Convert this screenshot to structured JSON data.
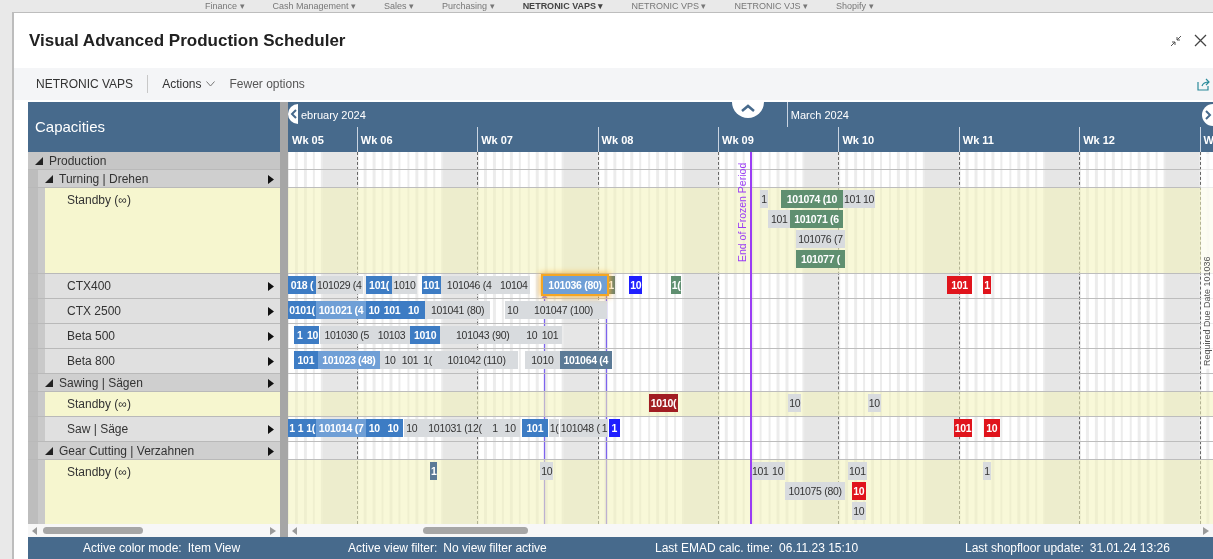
{
  "background_nav": [
    {
      "label": "Finance ▾",
      "selected": false
    },
    {
      "label": "Cash Management ▾",
      "selected": false
    },
    {
      "label": "Sales ▾",
      "selected": false
    },
    {
      "label": "Purchasing ▾",
      "selected": false
    },
    {
      "label": "NETRONIC VAPS ▾",
      "selected": true
    },
    {
      "label": "NETRONIC VPS ▾",
      "selected": false
    },
    {
      "label": "NETRONIC VJS ▾",
      "selected": false
    },
    {
      "label": "Shopify ▾",
      "selected": false
    }
  ],
  "window": {
    "title": "Visual Advanced Production Scheduler"
  },
  "action_bar": {
    "app": "NETRONIC VAPS",
    "actions": "Actions",
    "fewer_options": "Fewer options"
  },
  "timeline": {
    "months": [
      "ebruary 2024",
      "March 2024"
    ],
    "weeks": [
      "Wk 05",
      "Wk 06",
      "Wk 07",
      "Wk 08",
      "Wk 09",
      "Wk 10",
      "Wk 11",
      "Wk 12",
      "W"
    ],
    "frozen_period_label": "End of Frozen Period",
    "due_date_label": "Required Due Date 101036"
  },
  "capacities": {
    "title": "Capacities",
    "rows": [
      {
        "label": "Production",
        "kind": "group",
        "expanded": true,
        "menu": false,
        "children": [
          {
            "label": "Turning | Drehen",
            "kind": "group",
            "expanded": true,
            "menu": true,
            "children": [
              {
                "label": "Standby (∞)",
                "kind": "standby",
                "menu": false,
                "lanes": [
                  [
                    {
                      "text": "1",
                      "color": "#d8dbde",
                      "selected": false
                    },
                    {
                      "text": "101074 (10",
                      "color": "#5f8f70",
                      "selected": false
                    },
                    {
                      "text": "101",
                      "color": "#d8dbde",
                      "selected": false
                    },
                    {
                      "text": "10",
                      "color": "#d8dbde",
                      "selected": false
                    }
                  ],
                  [
                    {
                      "text": "101",
                      "color": "#d8dbde",
                      "selected": false
                    },
                    {
                      "text": "101071 (6",
                      "color": "#5f8f70",
                      "selected": false
                    }
                  ],
                  [
                    {
                      "text": "101076 (7",
                      "color": "#d8dbde",
                      "selected": false
                    }
                  ],
                  [
                    {
                      "text": "101077 (",
                      "color": "#5f8f70",
                      "selected": false
                    }
                  ]
                ]
              },
              {
                "label": "CTX400",
                "kind": "resource",
                "menu": true,
                "lanes": [
                  [
                    {
                      "text": "018 (",
                      "color": "#3d7cc4",
                      "selected": false
                    },
                    {
                      "text": "101029 (4",
                      "color": "#d8dbde",
                      "selected": false
                    },
                    {
                      "text": "101(",
                      "color": "#3d7cc4",
                      "selected": false
                    },
                    {
                      "text": "1010",
                      "color": "#d8dbde",
                      "selected": false
                    },
                    {
                      "text": "101",
                      "color": "#3d7cc4",
                      "selected": false
                    },
                    {
                      "text": "101046 (4",
                      "color": "#d8dbde",
                      "selected": false
                    },
                    {
                      "text": "10104",
                      "color": "#d8dbde",
                      "selected": false
                    },
                    {
                      "text": "101036 (80)",
                      "color": "#6f9fd6",
                      "selected": true
                    },
                    {
                      "text": "1",
                      "color": "#6b7f6a",
                      "selected": false
                    },
                    {
                      "text": "10",
                      "color": "#1f1fff",
                      "selected": false
                    },
                    {
                      "text": "1(",
                      "color": "#5f8f70",
                      "selected": false
                    },
                    {
                      "text": "101",
                      "color": "#e0141c",
                      "selected": false
                    },
                    {
                      "text": "1",
                      "color": "#e0141c",
                      "selected": false
                    }
                  ]
                ]
              },
              {
                "label": "CTX 2500",
                "kind": "resource",
                "menu": true,
                "lanes": [
                  [
                    {
                      "text": "0101(",
                      "color": "#3d7cc4",
                      "selected": false
                    },
                    {
                      "text": "101021 (4",
                      "color": "#6f9fd6",
                      "selected": false
                    },
                    {
                      "text": "10",
                      "color": "#3d7cc4",
                      "selected": false
                    },
                    {
                      "text": "101",
                      "color": "#3d7cc4",
                      "selected": false
                    },
                    {
                      "text": "10",
                      "color": "#3d7cc4",
                      "selected": false
                    },
                    {
                      "text": "101041 (80)",
                      "color": "#d8dbde",
                      "selected": false
                    },
                    {
                      "text": "10",
                      "color": "#d8dbde",
                      "selected": false
                    },
                    {
                      "text": "101047 (100)",
                      "color": "#d8dbde",
                      "selected": false
                    }
                  ]
                ]
              },
              {
                "label": "Beta 500",
                "kind": "resource",
                "menu": true,
                "lanes": [
                  [
                    {
                      "text": "1",
                      "color": "#3d7cc4",
                      "selected": false
                    },
                    {
                      "text": "10",
                      "color": "#3d7cc4",
                      "selected": false
                    },
                    {
                      "text": "101030 (5",
                      "color": "#d8dbde",
                      "selected": false
                    },
                    {
                      "text": "10103",
                      "color": "#d8dbde",
                      "selected": false
                    },
                    {
                      "text": "1010",
                      "color": "#3d7cc4",
                      "selected": false
                    },
                    {
                      "text": "101043 (90)",
                      "color": "#d8dbde",
                      "selected": false
                    },
                    {
                      "text": "10",
                      "color": "#d8dbde",
                      "selected": false
                    },
                    {
                      "text": "101",
                      "color": "#d8dbde",
                      "selected": false
                    }
                  ]
                ]
              },
              {
                "label": "Beta 800",
                "kind": "resource",
                "menu": true,
                "lanes": [
                  [
                    {
                      "text": "101",
                      "color": "#3d7cc4",
                      "selected": false
                    },
                    {
                      "text": "101023 (48)",
                      "color": "#6f9fd6",
                      "selected": false
                    },
                    {
                      "text": "10",
                      "color": "#d8dbde",
                      "selected": false
                    },
                    {
                      "text": "101",
                      "color": "#d8dbde",
                      "selected": false
                    },
                    {
                      "text": "1(",
                      "color": "#d8dbde",
                      "selected": false
                    },
                    {
                      "text": "101042 (110)",
                      "color": "#d8dbde",
                      "selected": false
                    },
                    {
                      "text": "1010",
                      "color": "#d8dbde",
                      "selected": false
                    },
                    {
                      "text": "101064 (4",
                      "color": "#5b7a96",
                      "selected": false
                    }
                  ]
                ]
              }
            ]
          },
          {
            "label": "Sawing | Sägen",
            "kind": "group",
            "expanded": true,
            "menu": true,
            "children": [
              {
                "label": "Standby (∞)",
                "kind": "standby",
                "menu": false,
                "lanes": [
                  [
                    {
                      "text": "1010(",
                      "color": "#a11d22",
                      "selected": false
                    },
                    {
                      "text": "10",
                      "color": "#d8dbde",
                      "selected": false
                    },
                    {
                      "text": "10",
                      "color": "#d8dbde",
                      "selected": false
                    }
                  ]
                ]
              },
              {
                "label": "Saw | Säge",
                "kind": "resource",
                "menu": true,
                "lanes": [
                  [
                    {
                      "text": "1",
                      "color": "#3d7cc4",
                      "selected": false
                    },
                    {
                      "text": "1",
                      "color": "#3d7cc4",
                      "selected": false
                    },
                    {
                      "text": "1(",
                      "color": "#3d7cc4",
                      "selected": false
                    },
                    {
                      "text": "101014 (7",
                      "color": "#6f9fd6",
                      "selected": false
                    },
                    {
                      "text": "10",
                      "color": "#3d7cc4",
                      "selected": false
                    },
                    {
                      "text": "10",
                      "color": "#3d7cc4",
                      "selected": false
                    },
                    {
                      "text": "10",
                      "color": "#d8dbde",
                      "selected": false
                    },
                    {
                      "text": "101031 (12(",
                      "color": "#d8dbde",
                      "selected": false
                    },
                    {
                      "text": "1",
                      "color": "#d8dbde",
                      "selected": false
                    },
                    {
                      "text": "10",
                      "color": "#d8dbde",
                      "selected": false
                    },
                    {
                      "text": "101",
                      "color": "#3d7cc4",
                      "selected": false
                    },
                    {
                      "text": "1(",
                      "color": "#d8dbde",
                      "selected": false
                    },
                    {
                      "text": "101048 (",
                      "color": "#d8dbde",
                      "selected": false
                    },
                    {
                      "text": "1",
                      "color": "#d8dbde",
                      "selected": false
                    },
                    {
                      "text": "1",
                      "color": "#1f1fff",
                      "selected": false
                    },
                    {
                      "text": "101",
                      "color": "#e0141c",
                      "selected": false
                    },
                    {
                      "text": "10",
                      "color": "#e0141c",
                      "selected": false
                    }
                  ]
                ]
              }
            ]
          },
          {
            "label": "Gear Cutting | Verzahnen",
            "kind": "group",
            "expanded": true,
            "menu": true,
            "children": [
              {
                "label": "Standby (∞)",
                "kind": "standby",
                "menu": false,
                "lanes": [
                  [
                    {
                      "text": "1",
                      "color": "#5b7a96",
                      "selected": false
                    },
                    {
                      "text": "10",
                      "color": "#d8dbde",
                      "selected": false
                    },
                    {
                      "text": "101",
                      "color": "#d8dbde",
                      "selected": false
                    },
                    {
                      "text": "10",
                      "color": "#d8dbde",
                      "selected": false
                    },
                    {
                      "text": "101",
                      "color": "#d8dbde",
                      "selected": false
                    },
                    {
                      "text": "1",
                      "color": "#d8dbde",
                      "selected": false
                    }
                  ],
                  [
                    {
                      "text": "101075 (80)",
                      "color": "#d8dbde",
                      "selected": false
                    },
                    {
                      "text": "10",
                      "color": "#e0141c",
                      "selected": false
                    }
                  ],
                  [
                    {
                      "text": "10",
                      "color": "#d8dbde",
                      "selected": false
                    }
                  ]
                ]
              }
            ]
          }
        ]
      }
    ]
  },
  "status_bar": [
    {
      "label": "Active color mode:",
      "value": "Item View"
    },
    {
      "label": "Active view filter:",
      "value": "No view filter active"
    },
    {
      "label": "Last EMAD calc. time:",
      "value": "06.11.23 15:10"
    },
    {
      "label": "Last shopfloor update:",
      "value": "31.01.24 13:26"
    }
  ]
}
